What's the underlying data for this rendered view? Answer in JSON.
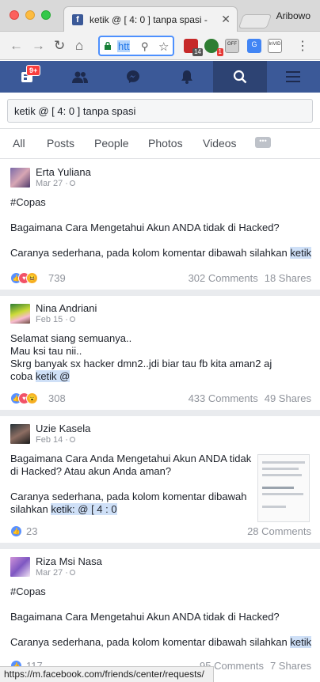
{
  "browser": {
    "tab_title": "ketik @ [ 4: 0 ] tanpa spasi -",
    "tab_favicon": "f",
    "profile": "Aribowo",
    "url": "htt",
    "extensions": [
      {
        "name": "ublock-icon",
        "badge": "14"
      },
      {
        "name": "grammarly-icon",
        "badge": "1"
      },
      {
        "name": "off-icon",
        "label": "OFF"
      },
      {
        "name": "translate-icon",
        "label": "G"
      },
      {
        "name": "invid-icon",
        "label": "InVID"
      }
    ]
  },
  "fbnav": {
    "friends_badge": "9+",
    "icons": [
      "home-icon",
      "friends-icon",
      "messenger-icon",
      "notifications-icon",
      "search-icon",
      "menu-icon"
    ],
    "brand_color": "#3b5998"
  },
  "search": {
    "value": "ketik @ [ 4: 0 ] tanpa spasi"
  },
  "filters": [
    "All",
    "Posts",
    "People",
    "Photos",
    "Videos"
  ],
  "posts": [
    {
      "author": "Erta Yuliana",
      "date": "Mar 27 ·",
      "lines": [
        "#Copas",
        "",
        "Bagaimana Cara Mengetahui Akun ANDA tidak di Hacked?",
        "",
        "Caranya sederhana, pada kolom komentar dibawah silahkan "
      ],
      "highlight": "ketik",
      "reactions": [
        "like",
        "love",
        "haha"
      ],
      "react_count": "739",
      "comments": "302 Comments",
      "shares": "18 Shares"
    },
    {
      "author": "Nina Andriani",
      "date": "Feb 15 ·",
      "lines": [
        "Selamat siang semuanya..",
        "Mau ksi tau nii..",
        "Skrg banyak sx hacker dmn2..jdi biar tau fb kita aman2 aj",
        "coba "
      ],
      "highlight": "ketik @",
      "reactions": [
        "like",
        "love",
        "wow"
      ],
      "react_count": "308",
      "comments": "433 Comments",
      "shares": "49 Shares"
    },
    {
      "author": "Uzie Kasela",
      "date": "Feb 14 ·",
      "lines": [
        "Bagaimana Cara Anda Mengetahui Akun ANDA tidak",
        "di Hacked? Atau akun Anda aman?",
        "",
        "Caranya sederhana, pada kolom komentar dibawah",
        "silahkan "
      ],
      "highlight": "ketik: @ [ 4 : 0",
      "reactions": [
        "like"
      ],
      "react_count": "23",
      "comments": "28 Comments",
      "shares": ""
    },
    {
      "author": "Riza Msi Nasa",
      "date": "Mar 27 ·",
      "lines": [
        "#Copas",
        "",
        "Bagaimana Cara Mengetahui Akun ANDA tidak di Hacked?",
        "",
        "Caranya sederhana, pada kolom komentar dibawah silahkan "
      ],
      "highlight": "ketik",
      "reactions": [
        "like"
      ],
      "react_count": "117",
      "comments": "95 Comments",
      "shares": "7 Shares"
    }
  ],
  "status_url": "https://m.facebook.com/friends/center/requests/"
}
